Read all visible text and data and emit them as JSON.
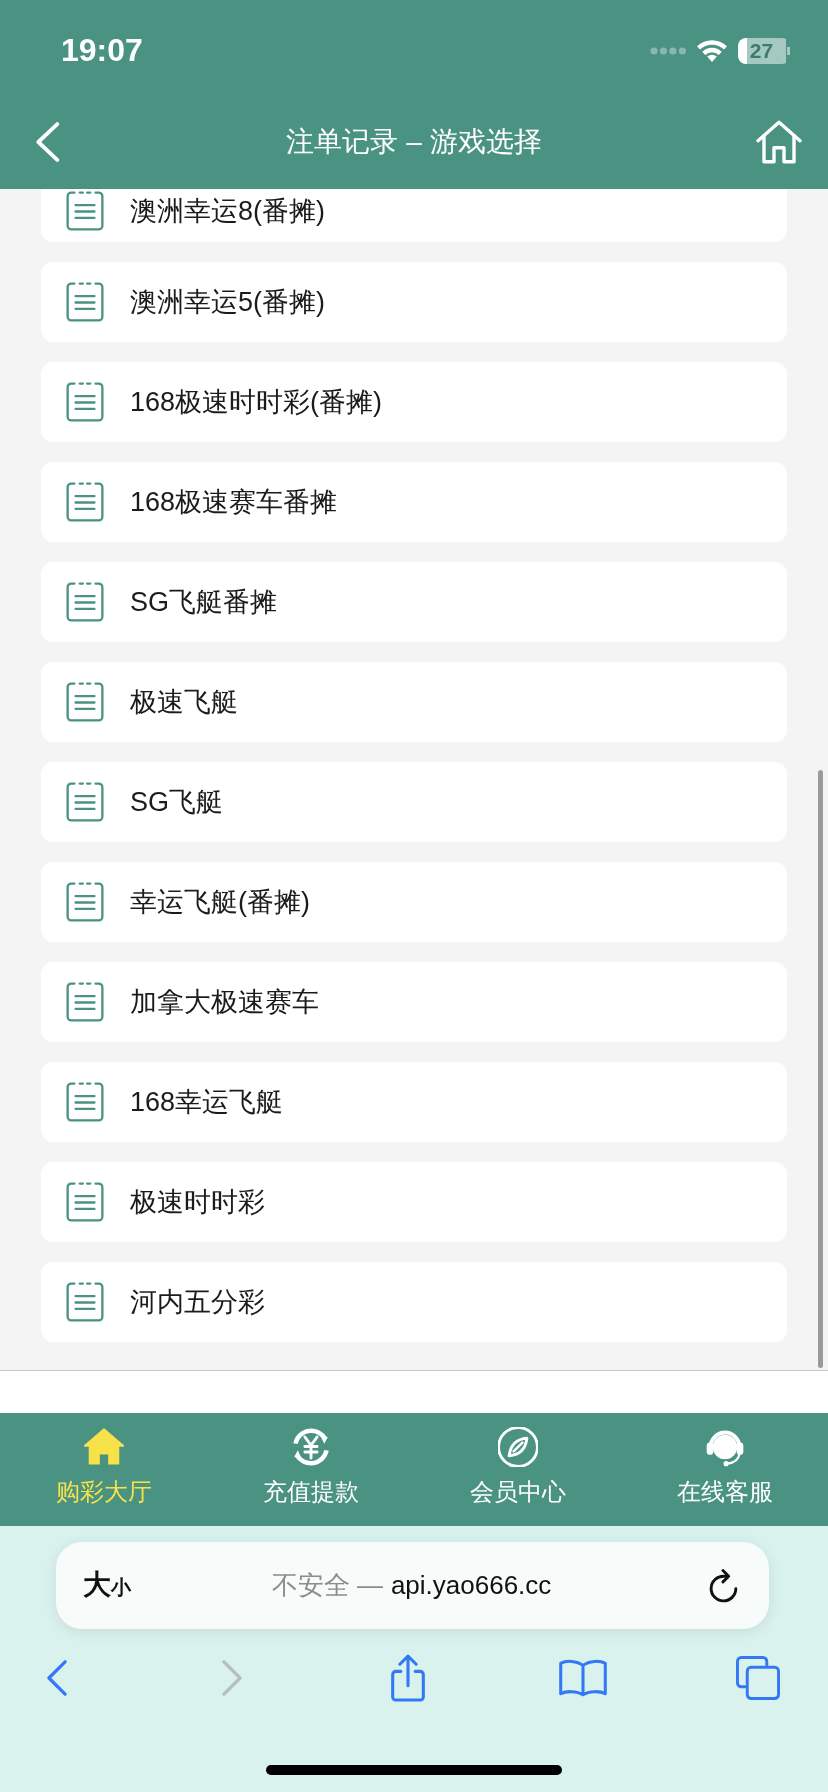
{
  "status_bar": {
    "time": "19:07",
    "battery": "27"
  },
  "header": {
    "title": "注单记录 – 游戏选择"
  },
  "games": [
    "澳洲幸运8(番摊)",
    "澳洲幸运5(番摊)",
    "168极速时时彩(番摊)",
    "168极速赛车番摊",
    "SG飞艇番摊",
    "极速飞艇",
    "SG飞艇",
    "幸运飞艇(番摊)",
    "加拿大极速赛车",
    "168幸运飞艇",
    "极速时时彩",
    "河内五分彩"
  ],
  "tab_bar": [
    {
      "label": "购彩大厅",
      "selected": true
    },
    {
      "label": "充值提款",
      "selected": false
    },
    {
      "label": "会员中心",
      "selected": false
    },
    {
      "label": "在线客服",
      "selected": false
    }
  ],
  "browser": {
    "page_settings": "大小",
    "security_label": "不安全 —",
    "url": "api.yao666.cc",
    "back_disabled": false,
    "forward_disabled": true
  }
}
